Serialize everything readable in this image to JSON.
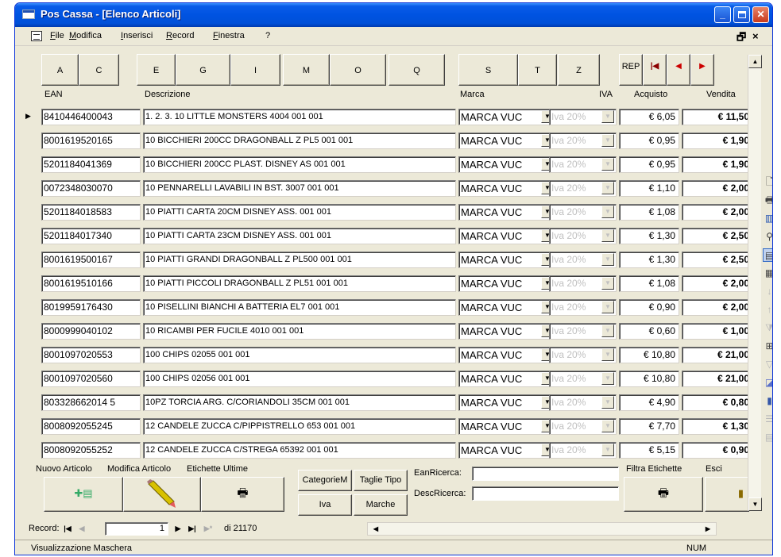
{
  "window": {
    "title": "Pos Cassa - [Elenco Articoli]"
  },
  "menubar": {
    "items": [
      "File",
      "Modifica",
      "Inserisci",
      "Record",
      "Finestra",
      "?"
    ],
    "mdi_restore": "🗗",
    "mdi_close": "×"
  },
  "letter_buttons": [
    "A",
    "C",
    "E",
    "G",
    "I",
    "M",
    "O",
    "Q",
    "S",
    "T",
    "Z",
    "REP"
  ],
  "columns": {
    "ean": "EAN",
    "description": "Descrizione",
    "brand": "Marca",
    "vat": "IVA",
    "purchase": "Acquisto",
    "sale": "Vendita"
  },
  "rows": [
    {
      "ean": "8410446400043",
      "description": "1. 2. 3. 10 LITTLE MONSTERS 4004 001   001",
      "brand": "MARCA VUC",
      "vat": "Iva 20%",
      "purchase": "€ 6,05",
      "sale": "€ 11,50"
    },
    {
      "ean": "8001619520165",
      "description": "10 BICCHIERI 200CC DRAGONBALL Z PL5 001   001",
      "brand": "MARCA VUC",
      "vat": "Iva 20%",
      "purchase": "€ 0,95",
      "sale": "€ 1,90"
    },
    {
      "ean": "5201184041369",
      "description": "10 BICCHIERI 200CC PLAST. DISNEY AS 001   001",
      "brand": "MARCA VUC",
      "vat": "Iva 20%",
      "purchase": "€ 0,95",
      "sale": "€ 1,90"
    },
    {
      "ean": "0072348030070",
      "description": "10 PENNARELLI LAVABILI IN BST. 3007 001   001",
      "brand": "MARCA VUC",
      "vat": "Iva 20%",
      "purchase": "€ 1,10",
      "sale": "€ 2,00"
    },
    {
      "ean": "5201184018583",
      "description": "10 PIATTI CARTA 20CM DISNEY ASS. 001   001",
      "brand": "MARCA VUC",
      "vat": "Iva 20%",
      "purchase": "€ 1,08",
      "sale": "€ 2,00"
    },
    {
      "ean": "5201184017340",
      "description": "10 PIATTI CARTA 23CM DISNEY ASS. 001   001",
      "brand": "MARCA VUC",
      "vat": "Iva 20%",
      "purchase": "€ 1,30",
      "sale": "€ 2,50"
    },
    {
      "ean": "8001619500167",
      "description": "10 PIATTI GRANDI DRAGONBALL Z PL500 001   001",
      "brand": "MARCA VUC",
      "vat": "Iva 20%",
      "purchase": "€ 1,30",
      "sale": "€ 2,50"
    },
    {
      "ean": "8001619510166",
      "description": "10 PIATTI PICCOLI DRAGONBALL Z PL51 001   001",
      "brand": "MARCA VUC",
      "vat": "Iva 20%",
      "purchase": "€ 1,08",
      "sale": "€ 2,00"
    },
    {
      "ean": "8019959176430",
      "description": "10 PISELLINI BIANCHI A BATTERIA EL7 001   001",
      "brand": "MARCA VUC",
      "vat": "Iva 20%",
      "purchase": "€ 0,90",
      "sale": "€ 2,00"
    },
    {
      "ean": "8000999040102",
      "description": "10 RICAMBI PER FUCILE 4010 001   001",
      "brand": "MARCA VUC",
      "vat": "Iva 20%",
      "purchase": "€ 0,60",
      "sale": "€ 1,00"
    },
    {
      "ean": "8001097020553",
      "description": "100 CHIPS 02055 001   001",
      "brand": "MARCA VUC",
      "vat": "Iva 20%",
      "purchase": "€ 10,80",
      "sale": "€ 21,00"
    },
    {
      "ean": "8001097020560",
      "description": "100 CHIPS 02056 001   001",
      "brand": "MARCA VUC",
      "vat": "Iva 20%",
      "purchase": "€ 10,80",
      "sale": "€ 21,00"
    },
    {
      "ean": "803328662014 5",
      "description": "10PZ TORCIA ARG. C/CORIANDOLI 35CM 001   001",
      "brand": "MARCA VUC",
      "vat": "Iva 20%",
      "purchase": "€ 4,90",
      "sale": "€ 0,80"
    },
    {
      "ean": "8008092055245",
      "description": "12 CANDELE ZUCCA C/PIPPISTRELLO 653 001   001",
      "brand": "MARCA VUC",
      "vat": "Iva 20%",
      "purchase": "€ 7,70",
      "sale": "€ 1,30"
    },
    {
      "ean": "8008092055252",
      "description": "12 CANDELE ZUCCA C/STREGA 65392 001   001",
      "brand": "MARCA VUC",
      "vat": "Iva 20%",
      "purchase": "€ 5,15",
      "sale": "€ 0,90"
    }
  ],
  "bottom": {
    "new_article": "Nuovo Articolo",
    "edit_article": "Modifica Articolo",
    "last_labels": "Etichette Ultime",
    "categories": "CategorieM",
    "sizes": "Taglie Tipo",
    "vat": "Iva",
    "brands": "Marche",
    "ean_search": "EanRicerca:",
    "desc_search": "DescRicerca:",
    "filter_labels": "Filtra Etichette",
    "exit": "Esci"
  },
  "nav": {
    "record_label": "Record:",
    "current": "1",
    "total": "di 21170"
  },
  "status": {
    "text": "Visualizzazione Maschera",
    "num": "NUM"
  },
  "icons": {
    "colors": {
      "title_blue": "#0053e1",
      "form_bg": "#ece9d8",
      "close_red": "#c8391c"
    }
  }
}
